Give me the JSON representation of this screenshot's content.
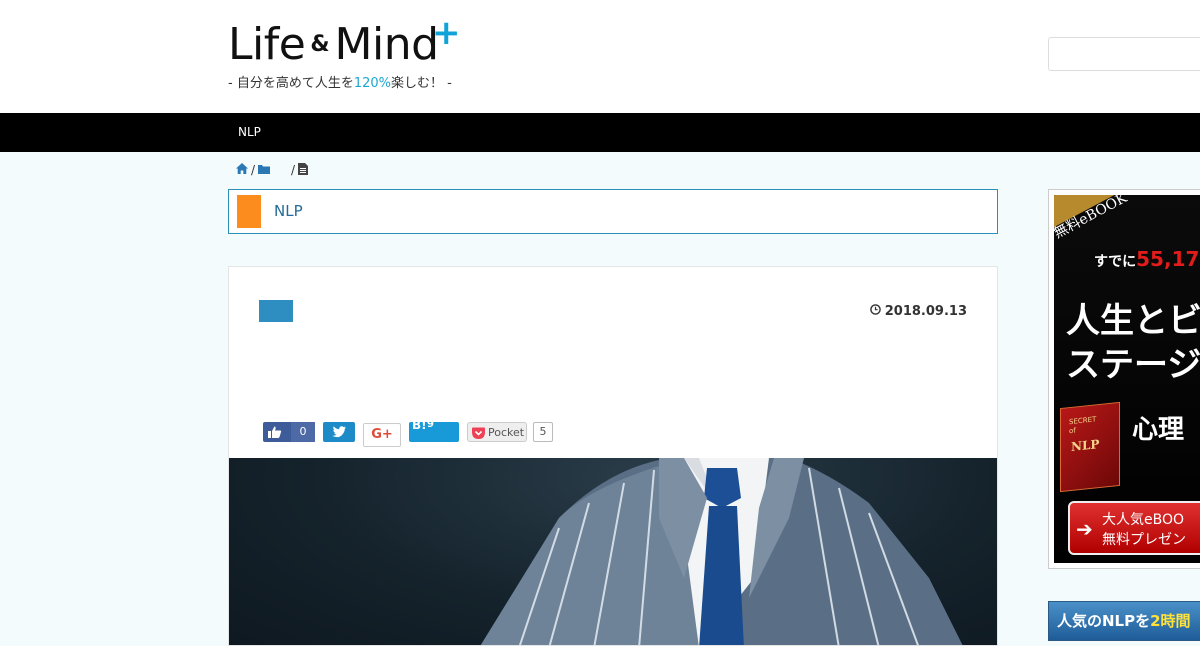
{
  "header": {
    "logo": {
      "word1": "Life",
      "amp": "&",
      "word2": "Mind",
      "plus": "+"
    },
    "tagline": {
      "before": "- 自分を高めて人生を",
      "accent": "120%",
      "after": "楽しむ！ -"
    }
  },
  "nav": {
    "items": [
      {
        "label": "NLP"
      }
    ]
  },
  "breadcrumb": {
    "sep1": "/",
    "sep2": "/"
  },
  "category": {
    "label": "NLP"
  },
  "article": {
    "date": "2018.09.13",
    "share": {
      "facebook_count": "0",
      "google_label": "G+",
      "hatena_label": "B!",
      "hatena_count": "9",
      "pocket_label": "Pocket",
      "pocket_count": "5"
    }
  },
  "sidebar": {
    "ad1": {
      "ribbon": "無料eBOOK",
      "line1_pre": "すでに",
      "line1_count": "55,17",
      "headline1": "人生とビ",
      "headline2": "ステージ",
      "book_line1": "SECRET",
      "book_line2": "of",
      "book_title": "NLP",
      "mid_text": "心理",
      "cta_line1": "大人気eBOO",
      "cta_line2": "無料プレゼン"
    },
    "ad2": {
      "pre": "人気のNLPを",
      "accent": "2時間"
    }
  },
  "colors": {
    "accent": "#1fa7d3",
    "nav_bg": "#000000",
    "category_mark": "#fb8c1d",
    "label_blue": "#2e8ec1"
  }
}
